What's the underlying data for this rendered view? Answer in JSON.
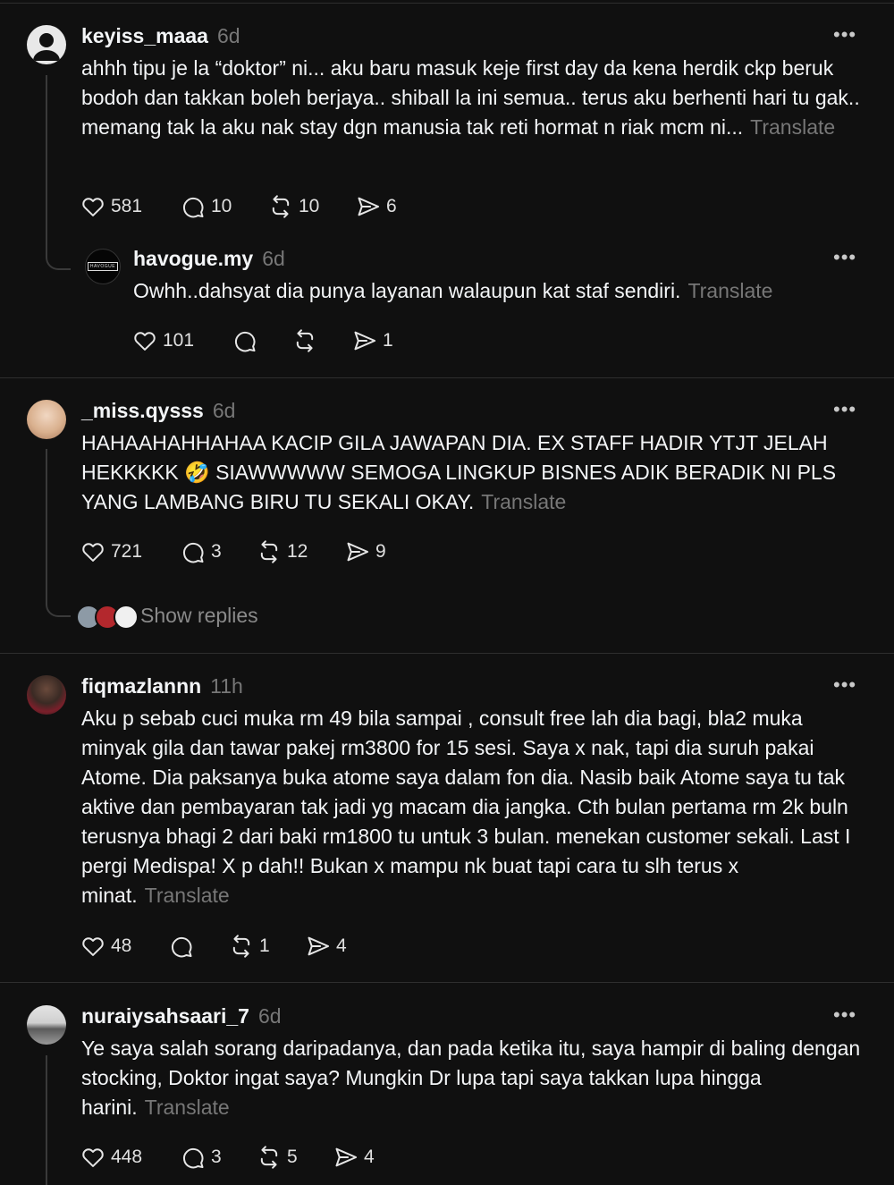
{
  "posts": [
    {
      "username": "keyiss_maaa",
      "time": "6d",
      "text": "ahhh tipu je la “doktor” ni... aku baru masuk keje first day da kena herdik ckp beruk bodoh dan takkan boleh berjaya.. shiball la ini semua.. terus aku berhenti hari tu gak.. memang tak la aku nak stay dgn manusia tak reti hormat n riak mcm ni...",
      "translate": "Translate",
      "likes": "581",
      "replies": "10",
      "reposts": "10",
      "shares": "6",
      "reply": {
        "username": "havogue.my",
        "time": "6d",
        "avatar_text": "HAVOGUE",
        "text": "Owhh..dahsyat dia punya layanan walaupun kat staf sendiri.",
        "translate": "Translate",
        "likes": "101",
        "replies": "",
        "reposts": "",
        "shares": "1"
      }
    },
    {
      "username": "_miss.qysss",
      "time": "6d",
      "text": "HAHAAHAHHAHAA KACIP GILA JAWAPAN DIA. EX STAFF HADIR YTJT JELAH HEKKKKK 🤣 SIAWWWWW SEMOGA LINGKUP BISNES ADIK BERADIK NI PLS YANG LAMBANG BIRU TU SEKALI OKAY.",
      "translate": "Translate",
      "likes": "721",
      "replies": "3",
      "reposts": "12",
      "shares": "9",
      "show_replies": "Show replies"
    },
    {
      "username": "fiqmazlannn",
      "time": "11h",
      "text": "Aku p sebab cuci muka rm 49 bila sampai , consult free lah dia bagi, bla2 muka minyak gila dan tawar pakej rm3800 for 15 sesi. Saya x nak, tapi dia suruh pakai Atome. Dia paksanya buka atome saya dalam fon dia. Nasib baik Atome saya tu tak aktive dan pembayaran tak jadi yg macam dia jangka. Cth bulan pertama rm 2k buln terusnya bhagi 2 dari baki rm1800 tu untuk 3 bulan. menekan customer sekali. Last I pergi Medispa! X p dah!! Bukan x mampu nk buat tapi cara tu slh terus x minat.",
      "translate": "Translate",
      "likes": "48",
      "replies": "",
      "reposts": "1",
      "shares": "4"
    },
    {
      "username": "nuraiysahsaari_7",
      "time": "6d",
      "text": "Ye saya salah sorang daripadanya, dan pada ketika itu, saya hampir di baling dengan stocking, Doktor ingat saya? Mungkin Dr lupa tapi saya takkan lupa hingga harini.",
      "translate": "Translate",
      "likes": "448",
      "replies": "3",
      "reposts": "5",
      "shares": "4"
    }
  ],
  "icons": {
    "like": "heart-icon",
    "reply": "comment-icon",
    "repost": "repost-icon",
    "share": "share-icon",
    "more": "more-icon"
  }
}
